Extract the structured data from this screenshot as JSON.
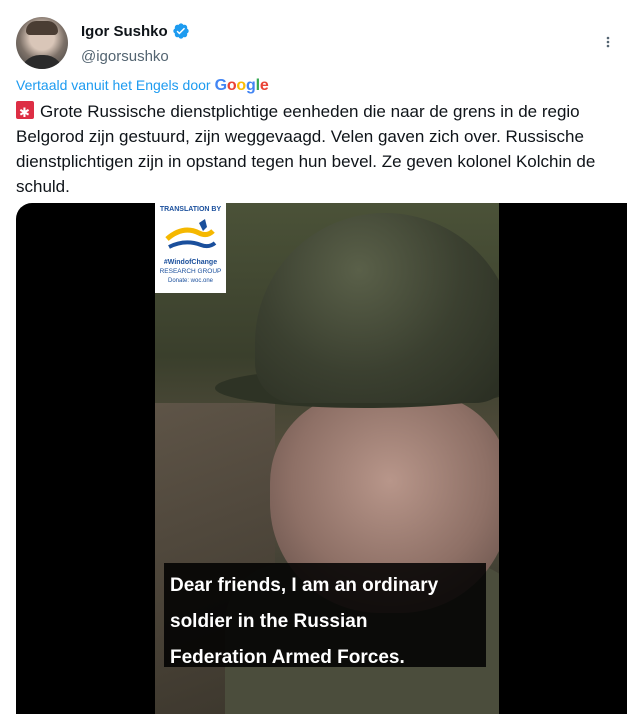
{
  "author": {
    "name": "Igor Sushko",
    "handle": "@igorsushko",
    "verified": true,
    "avatar_icon": "avatar-photo"
  },
  "translation": {
    "label": "Vertaald vanuit het Engels door",
    "provider": {
      "G": "G",
      "o1": "o",
      "o2": "o",
      "g": "g",
      "l": "l",
      "e": "e"
    }
  },
  "tweet": {
    "emoji_icon": "siren-icon",
    "text": "Grote Russische dienstplichtige eenheden die naar de grens in de regio Belgorod zijn gestuurd, zijn weggevaagd. Velen gaven zich over. Russische dienstplichtigen zijn in opstand tegen hun bevel. Ze geven kolonel Kolchin de schuld."
  },
  "media": {
    "watermark": {
      "top": "TRANSLATION BY",
      "line1": "#WindofChange",
      "line2": "RESEARCH GROUP",
      "line3": "Donate: woc.one"
    },
    "subtitle_lines": [
      "Dear friends, I am an ordinary",
      "soldier in the Russian",
      "Federation Armed Forces."
    ]
  },
  "colors": {
    "accent": "#1d9bf0",
    "text": "#0f1419",
    "muted": "#536471"
  }
}
